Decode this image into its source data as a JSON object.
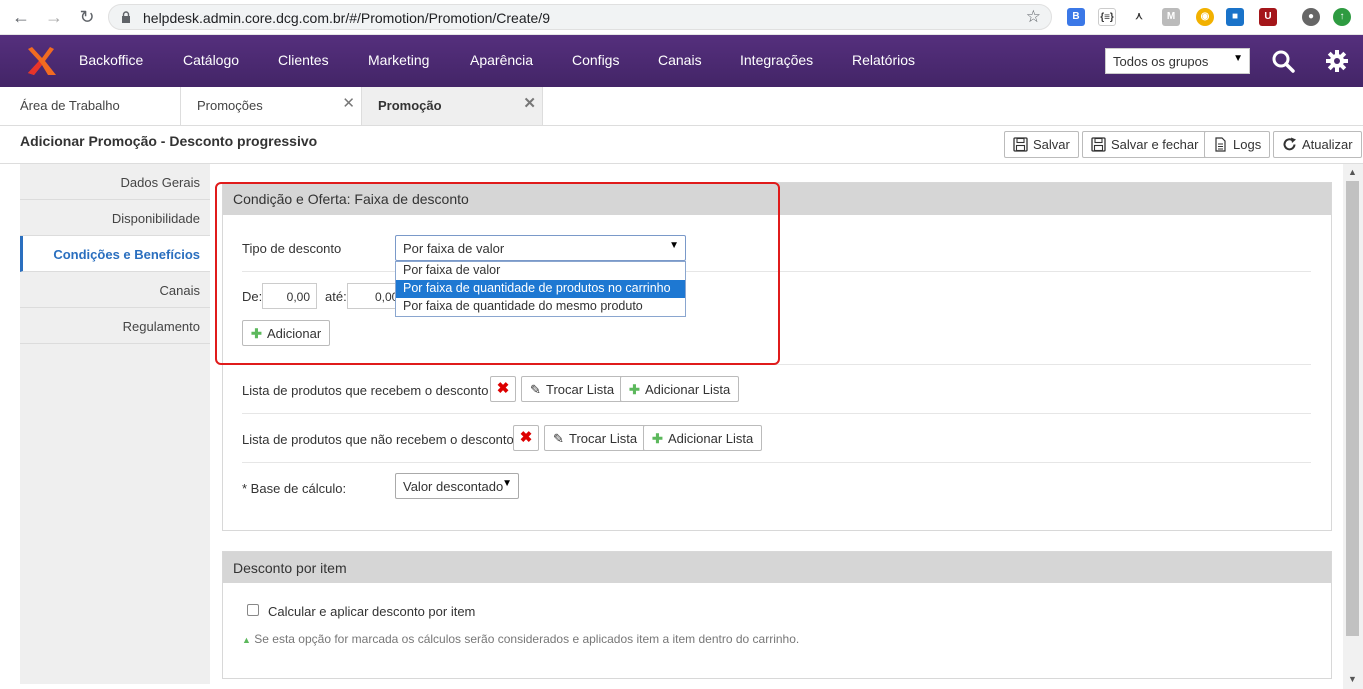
{
  "browser": {
    "url": "helpdesk.admin.core.dcg.com.br/#/Promotion/Promotion/Create/9"
  },
  "topnav": {
    "items": [
      "Backoffice",
      "Catálogo",
      "Clientes",
      "Marketing",
      "Aparência",
      "Configs",
      "Canais",
      "Integrações",
      "Relatórios"
    ],
    "group_select": "Todos os grupos"
  },
  "tabs": [
    {
      "label": "Área de Trabalho"
    },
    {
      "label": "Promoções"
    },
    {
      "label": "Promoção"
    }
  ],
  "page": {
    "title": "Adicionar Promoção - Desconto progressivo",
    "toolbar": {
      "save": "Salvar",
      "save_close": "Salvar e fechar",
      "logs": "Logs",
      "refresh": "Atualizar"
    }
  },
  "sidebar": {
    "items": [
      "Dados Gerais",
      "Disponibilidade",
      "Condições e Benefícios",
      "Canais",
      "Regulamento"
    ]
  },
  "condition_panel": {
    "title": "Condição e Oferta: Faixa de desconto",
    "discount_type_label": "Tipo de desconto",
    "discount_type_value": "Por faixa de valor",
    "options": [
      "Por faixa de valor",
      "Por faixa de quantidade de produtos no carrinho",
      "Por faixa de quantidade do mesmo produto"
    ],
    "from_label": "De:",
    "from_value": "0,00",
    "to_label": "até:",
    "to_value": "0,00",
    "add_label": "Adicionar",
    "list_receive_label": "Lista de produtos que recebem o desconto",
    "list_not_receive_label": "Lista de produtos que não recebem o desconto",
    "swap_list": "Trocar Lista",
    "add_list": "Adicionar Lista",
    "calc_base_label": "* Base de cálculo:",
    "calc_base_value": "Valor descontado"
  },
  "item_panel": {
    "title": "Desconto por item",
    "checkbox_label": "Calcular e aplicar desconto por item",
    "hint": "Se esta opção for marcada os cálculos serão considerados e aplicados item a item dentro do carrinho."
  }
}
